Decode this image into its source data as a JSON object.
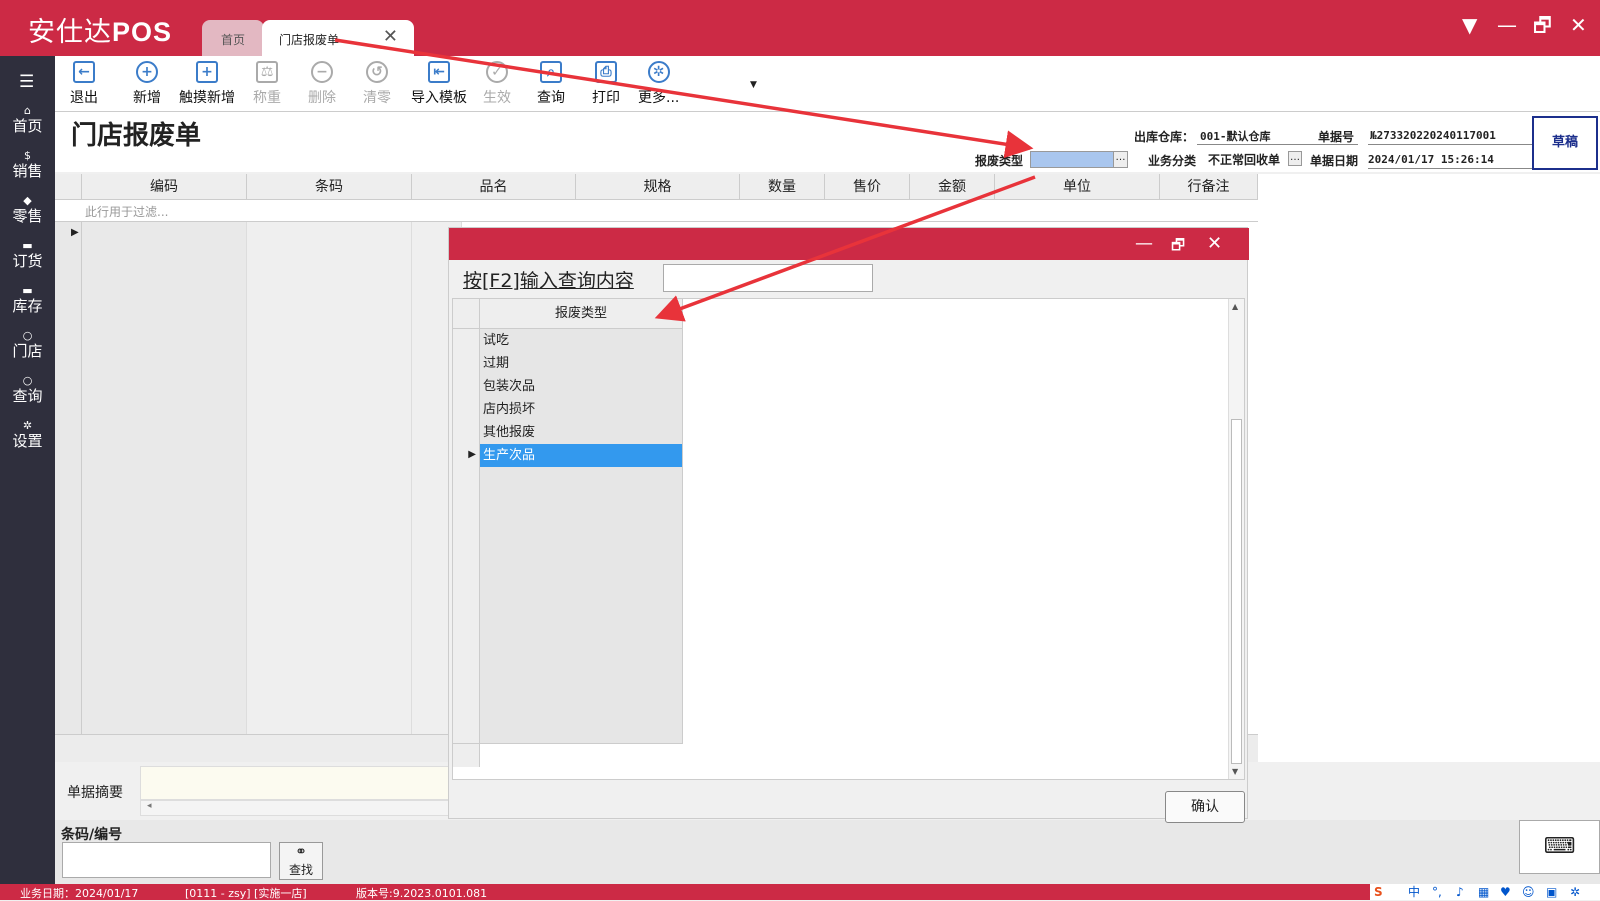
{
  "app": {
    "brand_cn": "安仕达",
    "brand_en": "POS"
  },
  "tabs": [
    {
      "label": "首页"
    },
    {
      "label": "门店报废单"
    }
  ],
  "window_controls": {
    "dropdown": "▼",
    "minimize": "—",
    "restore": "🗗",
    "close": "✕"
  },
  "sidebar": {
    "items": [
      {
        "label": "首页",
        "icon": "home-icon"
      },
      {
        "label": "销售",
        "icon": "currency-icon"
      },
      {
        "label": "零售",
        "icon": "tag-icon"
      },
      {
        "label": "订货",
        "icon": "box-icon"
      },
      {
        "label": "库存",
        "icon": "box-icon"
      },
      {
        "label": "门店",
        "icon": "search-icon"
      },
      {
        "label": "查询",
        "icon": "search-icon"
      },
      {
        "label": "设置",
        "icon": "gear-icon"
      }
    ]
  },
  "toolbar": {
    "items": [
      {
        "label": "退出",
        "icon": "exit-icon",
        "enabled": true
      },
      {
        "label": "新增",
        "icon": "plus-icon",
        "enabled": true
      },
      {
        "label": "触摸新增",
        "icon": "touch-add-icon",
        "enabled": true
      },
      {
        "label": "称重",
        "icon": "scale-icon",
        "enabled": false
      },
      {
        "label": "删除",
        "icon": "minus-icon",
        "enabled": false
      },
      {
        "label": "清零",
        "icon": "reset-icon",
        "enabled": false
      },
      {
        "label": "导入模板",
        "icon": "import-icon",
        "enabled": true
      },
      {
        "label": "生效",
        "icon": "check-icon",
        "enabled": false
      },
      {
        "label": "查询",
        "icon": "query-icon",
        "enabled": true
      },
      {
        "label": "打印",
        "icon": "print-icon",
        "enabled": true
      },
      {
        "label": "更多...",
        "icon": "gear-icon",
        "enabled": true
      }
    ]
  },
  "form": {
    "title": "门店报废单",
    "warehouse_label": "出库仓库：",
    "warehouse_value": "001-默认仓库",
    "doc_no_label": "单据号",
    "doc_no_value": "№273320220240117001",
    "scrap_type_label": "报废类型",
    "scrap_type_value": "",
    "biz_class_label": "业务分类",
    "biz_class_value": "不正常回收单",
    "doc_date_label": "单据日期",
    "doc_date_value": "2024/01/17 15:26:14",
    "status": "草稿"
  },
  "grid": {
    "columns": [
      "编码",
      "条码",
      "品名",
      "规格",
      "数量",
      "售价",
      "金额",
      "单位",
      "行备注"
    ],
    "filter_placeholder": "此行用于过滤..."
  },
  "summary": {
    "label": "单据摘要"
  },
  "barcode": {
    "label": "条码/编号",
    "find_label": "查找"
  },
  "statusbar": {
    "biz_date": "业务日期：2024/01/17",
    "user": "[0111 - zsy] [实施一店]",
    "version": "版本号:9.2023.0101.081",
    "ime": "中"
  },
  "dialog": {
    "search_label": "按[F2]输入查询内容",
    "column_header": "报废类型",
    "options": [
      "试吃",
      "过期",
      "包装次品",
      "店内损坏",
      "其他报废",
      "生产次品"
    ],
    "selected_index": 5,
    "confirm_label": "确认"
  }
}
